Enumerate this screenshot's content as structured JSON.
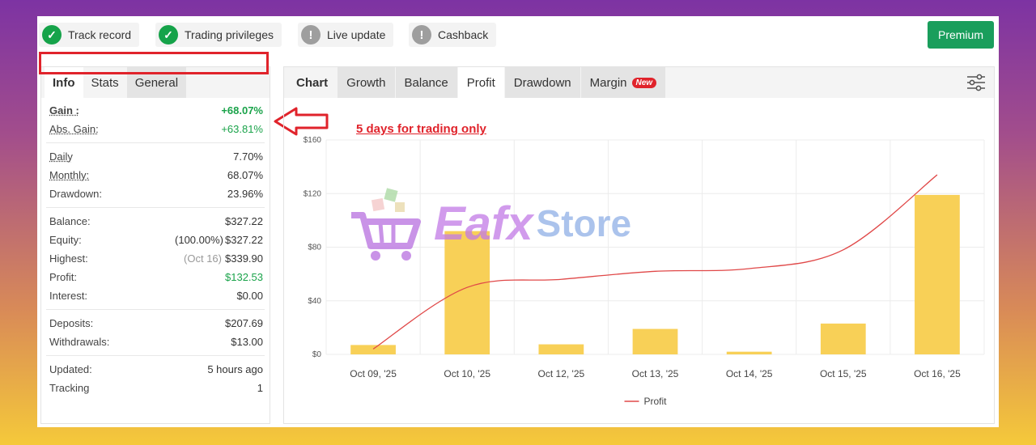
{
  "badges": [
    {
      "label": "Track record",
      "status": "ok"
    },
    {
      "label": "Trading privileges",
      "status": "ok"
    },
    {
      "label": "Live update",
      "status": "warn"
    },
    {
      "label": "Cashback",
      "status": "warn"
    }
  ],
  "premium_label": "Premium",
  "left_tabs": [
    "Info",
    "Stats",
    "General"
  ],
  "info": {
    "gain": {
      "label": "Gain :",
      "value": "+68.07%"
    },
    "abs_gain": {
      "label": "Abs. Gain:",
      "value": "+63.81%"
    },
    "daily": {
      "label": "Daily",
      "value": "7.70%"
    },
    "monthly": {
      "label": "Monthly:",
      "value": "68.07%"
    },
    "drawdown": {
      "label": "Drawdown:",
      "value": "23.96%"
    },
    "balance": {
      "label": "Balance:",
      "value": "$327.22"
    },
    "equity": {
      "label": "Equity:",
      "prefix": "(100.00%)",
      "value": "$327.22"
    },
    "highest": {
      "label": "Highest:",
      "prefix": "(Oct 16)",
      "value": "$339.90"
    },
    "profit": {
      "label": "Profit:",
      "value": "$132.53"
    },
    "interest": {
      "label": "Interest:",
      "value": "$0.00"
    },
    "deposits": {
      "label": "Deposits:",
      "value": "$207.69"
    },
    "withdrawals": {
      "label": "Withdrawals:",
      "value": "$13.00"
    },
    "updated": {
      "label": "Updated:",
      "value": "5 hours ago"
    },
    "tracking": {
      "label": "Tracking",
      "value": "1"
    }
  },
  "chart_tabs": [
    "Chart",
    "Growth",
    "Balance",
    "Profit",
    "Drawdown",
    "Margin"
  ],
  "new_badge": "New",
  "annotation": "5 days for trading only",
  "watermark": {
    "part1": "Eafx",
    "part2": "Store"
  },
  "colors": {
    "accent_green": "#1a9e5c",
    "gain_green": "#1aa34a",
    "highlight_red": "#e0232b",
    "bar_yellow": "#f8d057",
    "line_red": "#e04848"
  },
  "chart_data": {
    "type": "bar",
    "categories": [
      "Oct 09, '25",
      "Oct 10, '25",
      "Oct 12, '25",
      "Oct 13, '25",
      "Oct 14, '25",
      "Oct 15, '25",
      "Oct 16, '25"
    ],
    "series": [
      {
        "type": "bar",
        "values": [
          7,
          92,
          7.5,
          19,
          2,
          23,
          119
        ]
      },
      {
        "name": "Profit",
        "type": "line",
        "values": [
          4,
          50,
          56,
          62,
          64,
          78,
          134
        ]
      }
    ],
    "y_ticks": [
      "$0",
      "$40",
      "$80",
      "$120",
      "$160"
    ],
    "ylim": [
      0,
      160
    ],
    "legend": "bottom-center",
    "grid": true
  }
}
